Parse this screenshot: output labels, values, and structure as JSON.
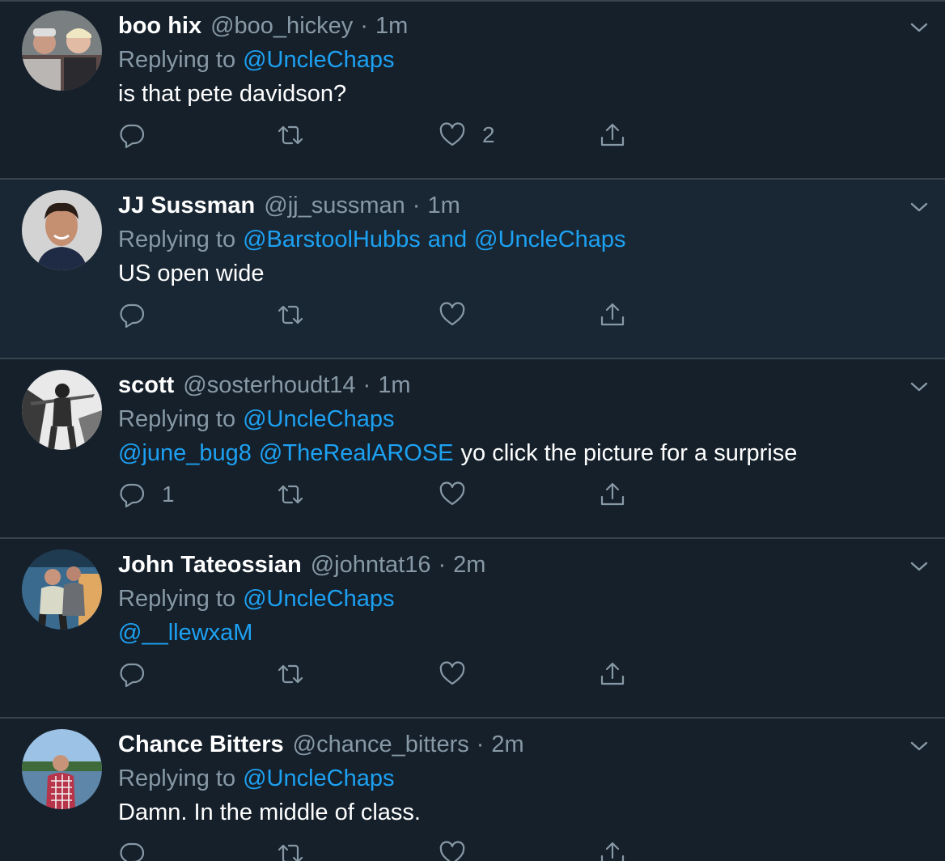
{
  "labels": {
    "replying_to": "Replying to",
    "and": "and"
  },
  "tweets": [
    {
      "name": "boo hix",
      "handle": "@boo_hickey",
      "time": "1m",
      "reply_to": [
        "@UncleChaps"
      ],
      "body_mentions": [],
      "body_text": "is that pete davidson?",
      "reply_count": "",
      "like_count": "2",
      "highlighted": false
    },
    {
      "name": "JJ Sussman",
      "handle": "@jj_sussman",
      "time": "1m",
      "reply_to": [
        "@BarstoolHubbs",
        "@UncleChaps"
      ],
      "body_mentions": [],
      "body_text": "US open wide",
      "reply_count": "",
      "like_count": "",
      "highlighted": true
    },
    {
      "name": "scott",
      "handle": "@sosterhoudt14",
      "time": "1m",
      "reply_to": [
        "@UncleChaps"
      ],
      "body_mentions": [
        "@june_bug8",
        "@TheRealAROSE"
      ],
      "body_text": "yo click the picture for a surprise",
      "reply_count": "1",
      "like_count": "",
      "highlighted": false
    },
    {
      "name": "John Tateossian",
      "handle": "@johntat16",
      "time": "2m",
      "reply_to": [
        "@UncleChaps"
      ],
      "body_mentions": [
        "@__llewxaM"
      ],
      "body_text": "",
      "reply_count": "",
      "like_count": "",
      "highlighted": false
    },
    {
      "name": "Chance Bitters",
      "handle": "@chance_bitters",
      "time": "2m",
      "reply_to": [
        "@UncleChaps"
      ],
      "body_mentions": [],
      "body_text": "Damn. In the middle of class.",
      "reply_count": "",
      "like_count": "",
      "highlighted": false
    }
  ],
  "icons": {
    "reply": "reply-icon",
    "retweet": "retweet-icon",
    "like": "like-icon",
    "share": "share-icon",
    "menu": "chevron-down-icon"
  },
  "colors": {
    "background": "#15202b",
    "highlight_background": "#192734",
    "border": "#38444d",
    "muted_text": "#8899a6",
    "link": "#1da1f2",
    "text": "#ffffff"
  }
}
